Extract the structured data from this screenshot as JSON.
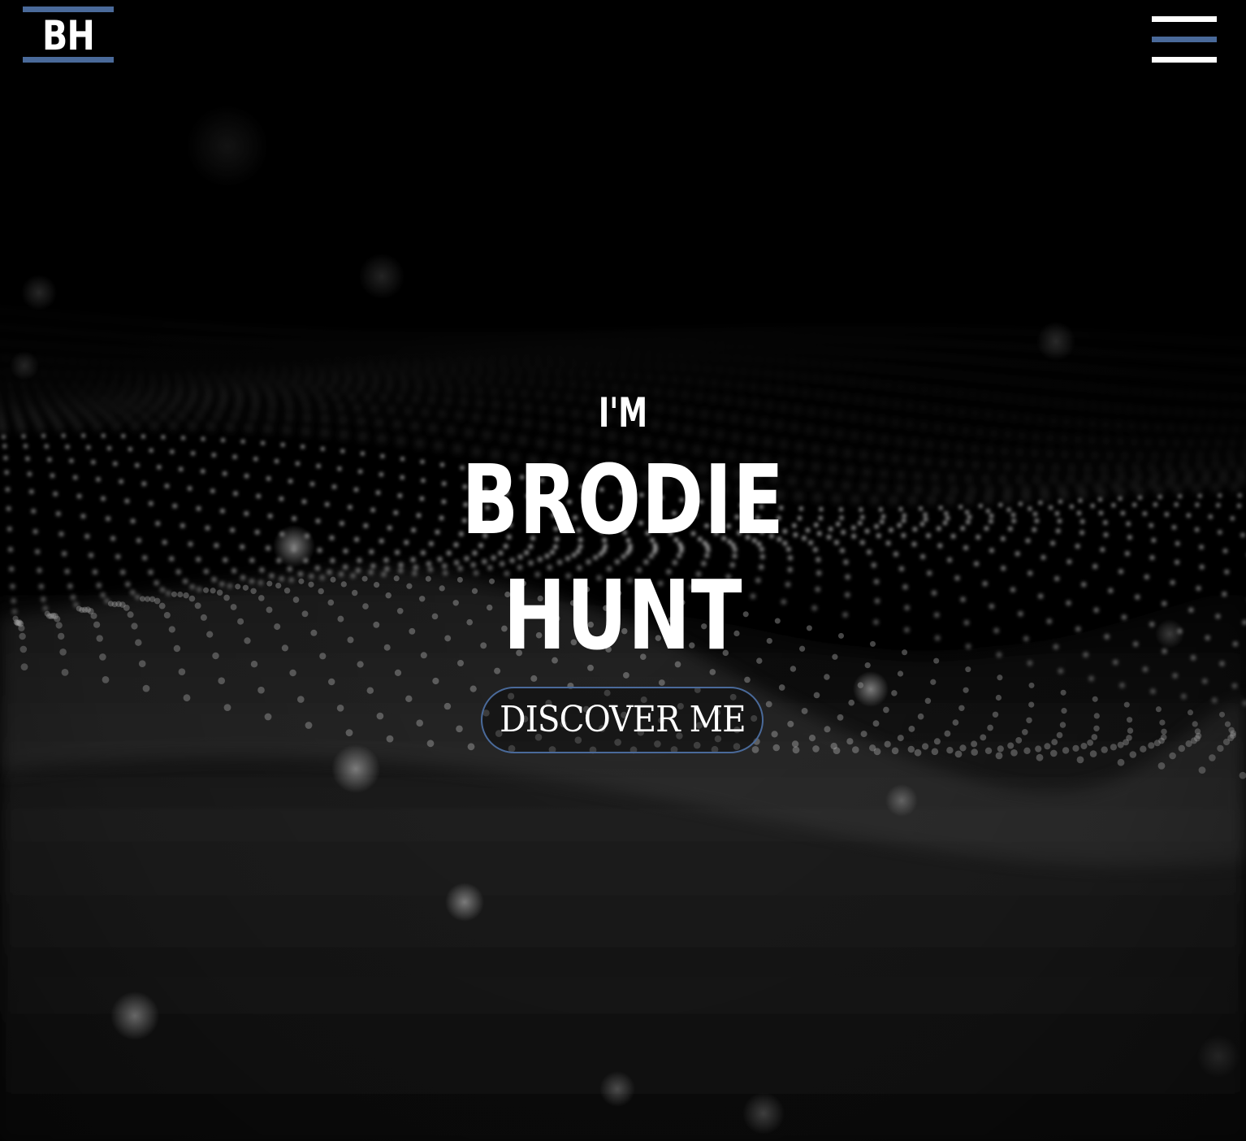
{
  "header": {
    "logo_text": "BH",
    "menu_icon": "hamburger-menu-icon"
  },
  "hero": {
    "intro": "I'M",
    "first_name": "BRODIE",
    "last_name": "HUNT",
    "cta_label": "DISCOVER ME",
    "background": "particle-wave-image"
  },
  "colors": {
    "accent": "#4a6a9a",
    "background": "#000000",
    "text": "#ffffff"
  }
}
